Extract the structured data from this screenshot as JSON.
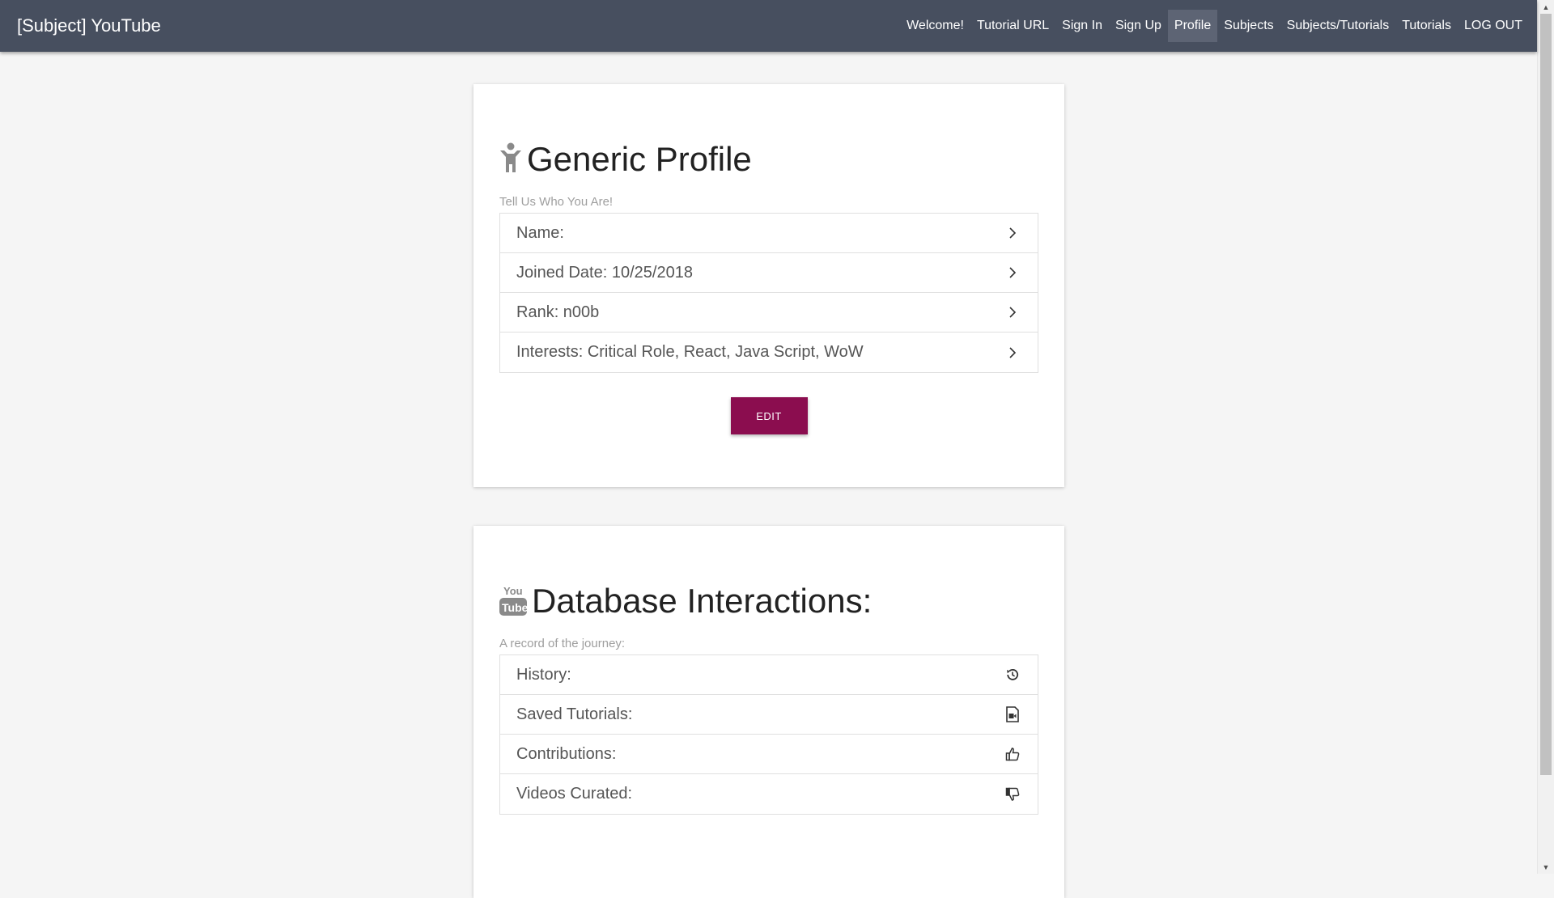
{
  "navbar": {
    "brand": "[Subject] YouTube",
    "links": [
      {
        "label": "Welcome!",
        "active": false
      },
      {
        "label": "Tutorial URL",
        "active": false
      },
      {
        "label": "Sign In",
        "active": false
      },
      {
        "label": "Sign Up",
        "active": false
      },
      {
        "label": "Profile",
        "active": true
      },
      {
        "label": "Subjects",
        "active": false
      },
      {
        "label": "Subjects/Tutorials",
        "active": false
      },
      {
        "label": "Tutorials",
        "active": false
      },
      {
        "label": "LOG OUT",
        "active": false
      }
    ]
  },
  "profile_card": {
    "icon": "person-icon",
    "title": "Generic Profile",
    "subtitle": "Tell Us Who You Are!",
    "items": [
      {
        "label": "Name:",
        "icon": "chevron-right-icon"
      },
      {
        "label": "Joined Date: 10/25/2018",
        "icon": "chevron-right-icon"
      },
      {
        "label": "Rank: n00b",
        "icon": "chevron-right-icon"
      },
      {
        "label": "Interests: Critical Role, React, Java Script, WoW",
        "icon": "chevron-right-icon"
      }
    ],
    "edit_label": "EDIT",
    "edit_color": "#8b0d4f"
  },
  "db_card": {
    "icon": "youtube-icon",
    "title": "Database Interactions:",
    "subtitle": "A record of the journey:",
    "items": [
      {
        "label": "History:",
        "icon": "history-icon"
      },
      {
        "label": "Saved Tutorials:",
        "icon": "saved-video-icon"
      },
      {
        "label": "Contributions:",
        "icon": "thumbs-up-icon"
      },
      {
        "label": "Videos Curated:",
        "icon": "thumbs-down-icon"
      }
    ]
  },
  "colors": {
    "navbar": "#474f5f",
    "navbar_active": "#5d6474",
    "accent": "#8b0d4f",
    "background": "#f5f5f5"
  }
}
